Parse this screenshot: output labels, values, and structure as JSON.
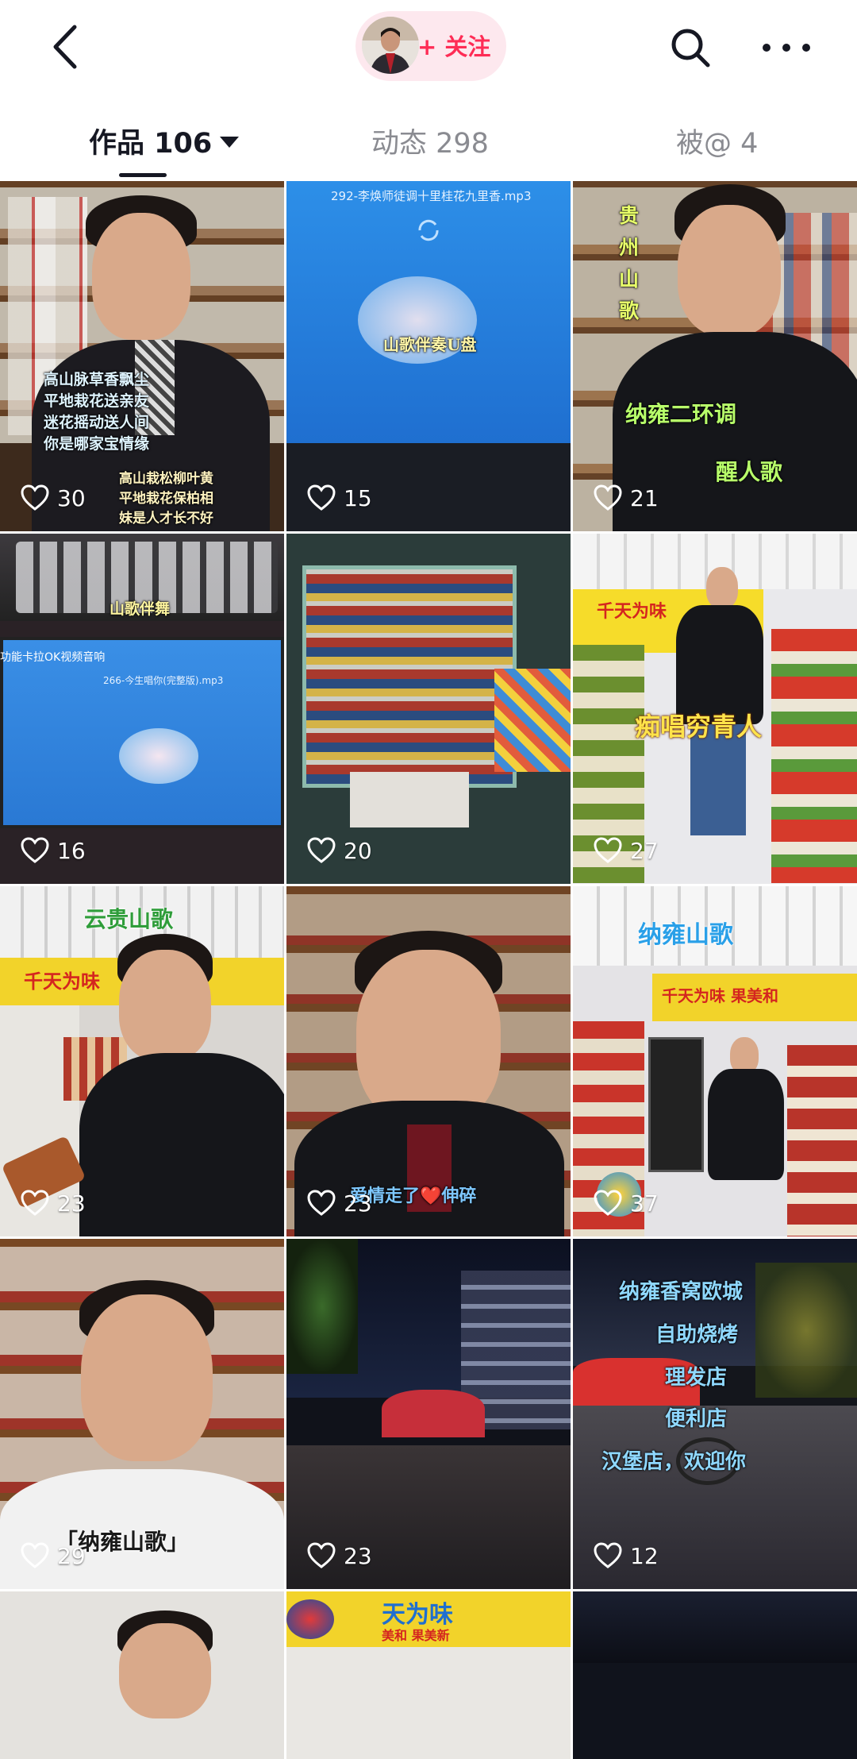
{
  "header": {
    "follow_label": "+ 关注",
    "accent_color": "#fe2c55"
  },
  "tabs": [
    {
      "label": "作品 106",
      "active": true
    },
    {
      "label": "动态 298",
      "active": false
    },
    {
      "label": "被@ 4",
      "active": false
    }
  ],
  "videos": [
    {
      "likes": "30",
      "captions": [
        "高山脉草香飘尘",
        "平地栽花送亲友",
        "迷花摇动送人间",
        "你是哪家宝情缘",
        "高山栽松柳叶黄",
        "平地栽花保柏相",
        "妹是人才长不好"
      ]
    },
    {
      "likes": "15",
      "captions": [
        "292-李焕师徒调十里桂花九里香.mp3",
        "山歌伴奏U盘"
      ]
    },
    {
      "likes": "21",
      "captions": [
        "贵",
        "州",
        "山",
        "歌",
        "纳雍二环调",
        "醒人歌"
      ]
    },
    {
      "likes": "16",
      "captions": [
        "山歌伴舞",
        "功能卡拉OK视频音响",
        "266-今生唱你(完整版).mp3"
      ]
    },
    {
      "likes": "20",
      "captions": []
    },
    {
      "likes": "27",
      "captions": [
        "千天为味",
        "痴唱穷青人"
      ]
    },
    {
      "likes": "23",
      "captions": [
        "云贵山歌",
        "千天为味"
      ]
    },
    {
      "likes": "23",
      "captions": [
        "爱情走了❤️伸碎"
      ]
    },
    {
      "likes": "37",
      "captions": [
        "纳雍山歌",
        "千天为味 果美和"
      ]
    },
    {
      "likes": "29",
      "captions": [
        "「纳雍山歌」"
      ]
    },
    {
      "likes": "23",
      "captions": []
    },
    {
      "likes": "12",
      "captions": [
        "纳雍香窝欧城",
        "自助烧烤",
        "理发店",
        "便利店",
        "汉堡店，欢迎你"
      ]
    },
    {
      "likes": "",
      "captions": []
    },
    {
      "likes": "",
      "captions": [
        "天为味",
        "美和 果美新"
      ]
    },
    {
      "likes": "",
      "captions": []
    }
  ]
}
